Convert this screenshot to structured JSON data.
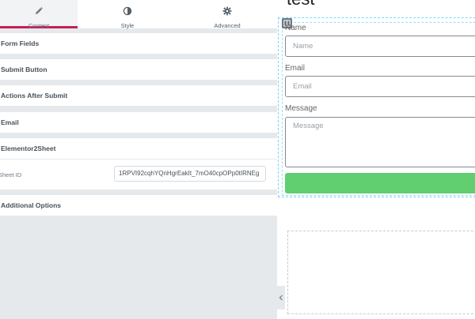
{
  "panel": {
    "tabs": [
      {
        "label": "Content",
        "icon": "pencil-icon"
      },
      {
        "label": "Style",
        "icon": "half-circle-icon"
      },
      {
        "label": "Advanced",
        "icon": "gear-icon"
      }
    ],
    "sections": [
      {
        "title": "Form Fields"
      },
      {
        "title": "Submit Button"
      },
      {
        "title": "Actions After Submit"
      },
      {
        "title": "Email"
      },
      {
        "title": "Elementor2Sheet"
      },
      {
        "title": "Additional Options"
      }
    ],
    "sheet_field": {
      "label": "Sheet ID",
      "value": "1RPVI92cqhYQnHgrEakIt_7mO40cpOPp0tIRNEg"
    }
  },
  "preview": {
    "page_title": "test",
    "form": {
      "fields": [
        {
          "label": "Name",
          "placeholder": "Name"
        },
        {
          "label": "Email",
          "placeholder": "Email"
        },
        {
          "label": "Message",
          "placeholder": "Message"
        }
      ],
      "submit_label": ""
    }
  },
  "colors": {
    "accent_tab": "#c51e5a",
    "submit_button": "#61ce70",
    "selection_outline": "#71d7f7",
    "panel_background": "#e6e9ec"
  }
}
